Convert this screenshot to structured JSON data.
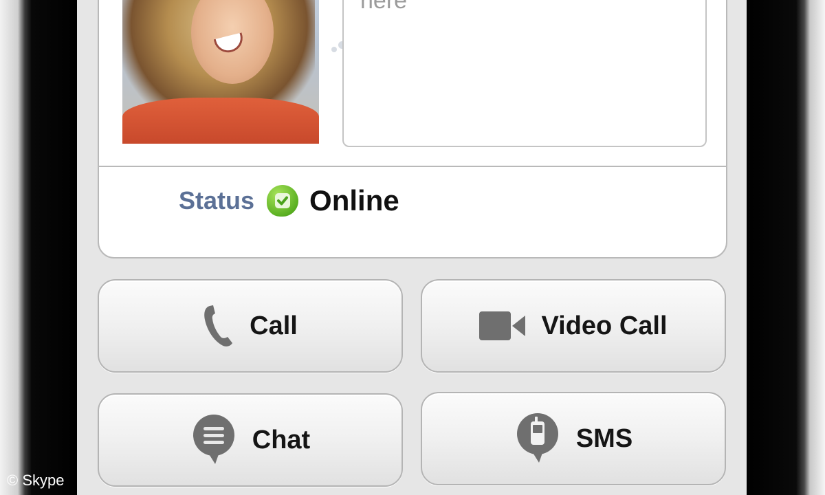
{
  "profile": {
    "mood_message": "here",
    "status_label": "Status",
    "status_value": "Online"
  },
  "actions": {
    "call_label": "Call",
    "video_call_label": "Video Call",
    "chat_label": "Chat",
    "sms_label": "SMS"
  },
  "icons": {
    "status": "online-check-icon",
    "call": "phone-handset-icon",
    "video_call": "video-camera-icon",
    "chat": "chat-bubble-icon",
    "sms": "mobile-phone-bubble-icon"
  },
  "colors": {
    "status_label": "#5b7096",
    "status_online": "#5bb022",
    "icon_gray": "#6f6f6f"
  },
  "watermark": "© Skype"
}
